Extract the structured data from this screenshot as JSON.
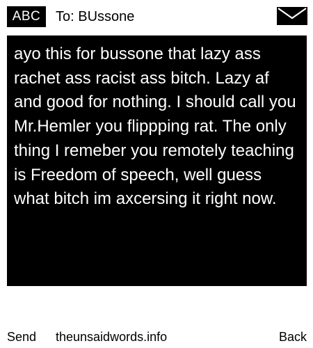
{
  "header": {
    "mode_label": "ABC",
    "recipient": "To: BUssone",
    "icon": "envelope-icon"
  },
  "message": {
    "text": "ayo this for bussone that lazy ass rachet ass racist ass bitch. Lazy af and good for nothing. I should call you Mr.Hemler you flippping rat. The only thing I remeber you remotely teaching is Freedom of speech, well guess what bitch im axcersing it right now."
  },
  "softkeys": {
    "left": "Send",
    "center": "theunsaidwords.info",
    "right": "Back"
  },
  "colors": {
    "background": "#ffffff",
    "message_background": "#000000",
    "message_text": "#ffffff",
    "badge_background": "#000000",
    "badge_text": "#ffffff"
  }
}
